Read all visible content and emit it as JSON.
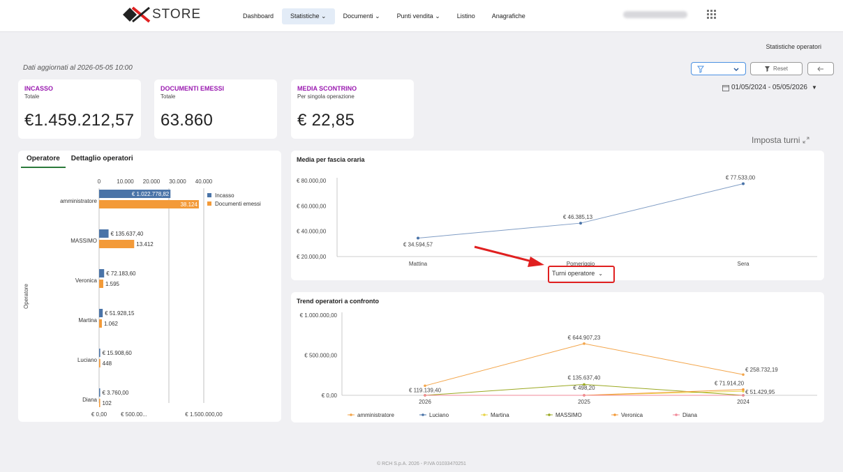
{
  "header": {
    "logo_text": "STORE",
    "nav": [
      {
        "label": "Dashboard"
      },
      {
        "label": "Statistiche ⌄"
      },
      {
        "label": "Documenti ⌄"
      },
      {
        "label": "Punti vendita ⌄"
      },
      {
        "label": "Listino"
      },
      {
        "label": "Anagrafiche"
      }
    ],
    "active_nav": "Statistiche",
    "apps_icon": "grid-icon"
  },
  "page": {
    "subtitle": "Statistiche operatori",
    "updated": "Dati aggiornati al 2026-05-05 10:00",
    "reset_label": "Reset",
    "date_range": "01/05/2024 - 05/05/2026",
    "shifts_label": "Imposta turni"
  },
  "kpis": [
    {
      "title": "INCASSO",
      "subtitle": "Totale",
      "value": "€1.459.212,57"
    },
    {
      "title": "DOCUMENTI EMESSI",
      "subtitle": "Totale",
      "value": "63.860"
    },
    {
      "title": "MEDIA SCONTRINO",
      "subtitle": "Per singola operazione",
      "value": "€ 22,85"
    }
  ],
  "tabs": {
    "operatore": "Operatore",
    "dettaglio": "Dettaglio operatori"
  },
  "ops_chart_text": {
    "y_axis_title": "Operatore",
    "top_ticks": [
      "0",
      "10.000",
      "20.000",
      "30.000",
      "40.000"
    ],
    "bottom_ticks": [
      "€ 0,00",
      "€ 500.00...",
      "€ 1.500.000,00"
    ],
    "legend": [
      "Incasso",
      "Documenti emessi"
    ]
  },
  "hourly_chart_title": "Media per fascia oraria",
  "hourly_y_ticks": [
    "€ 80.000,00",
    "€ 60.000,00",
    "€ 40.000,00",
    "€ 20.000,00"
  ],
  "shift_dropdown": "Turni operatore",
  "trend_chart_title": "Trend operatori a confronto",
  "trend_y_ticks": [
    "€ 1.000.000,00",
    "€ 500.000,00",
    "€ 0,00"
  ],
  "trend_labels": {
    "admin_2026": "€ 119.139,40",
    "admin_2025": "€ 644.907,23",
    "admin_2024": "€ 258.732,19",
    "massimo_2025": "€ 135.637,40",
    "veronica_2025": "€ 498,20",
    "veronica_2024": "€ 71.914,20",
    "martina_2024": "€ 51.429,95"
  },
  "footer": "© RCH S.p.A. 2026 - P.IVA 01033470251",
  "colors": {
    "accent": "#9a1ab0",
    "incasso": "#4a74a8",
    "documenti": "#f39a38",
    "line": "#7f9cc4"
  },
  "chart_data": [
    {
      "type": "bar",
      "orientation": "horizontal",
      "categories": [
        "amministratore",
        "MASSIMO",
        "Veronica",
        "Martina",
        "Luciano",
        "Diana"
      ],
      "series": [
        {
          "name": "Incasso",
          "axis": "bottom",
          "values": [
            1022778.82,
            135637.4,
            72183.6,
            51928.15,
            15908.6,
            3760.0
          ],
          "labels": [
            "€ 1.022.778,82",
            "€ 135.637,40",
            "€ 72.183,60",
            "€ 51.928,15",
            "€ 15.908,60",
            "€ 3.760,00"
          ]
        },
        {
          "name": "Documenti emessi",
          "axis": "top",
          "values": [
            38124,
            13412,
            1595,
            1062,
            448,
            102
          ],
          "labels": [
            "38.124",
            "13.412",
            "1.595",
            "1.062",
            "448",
            "102"
          ]
        }
      ],
      "ylabel": "Operatore",
      "xlim_top": [
        0,
        40000
      ],
      "xlim_bottom": [
        0,
        1500000
      ],
      "legend": "right"
    },
    {
      "type": "line",
      "title": "Media per fascia oraria",
      "categories": [
        "Mattina",
        "Pomeriggio",
        "Sera"
      ],
      "series": [
        {
          "values": [
            34594.57,
            46385.13,
            77533.0
          ],
          "labels": [
            "€ 34.594,57",
            "€ 46.385,13",
            "€ 77.533,00"
          ]
        }
      ],
      "ylim": [
        20000,
        80000
      ]
    },
    {
      "type": "line",
      "title": "Trend operatori a confronto",
      "categories": [
        "2026",
        "2025",
        "2024"
      ],
      "series": [
        {
          "name": "amministratore",
          "color": "#f3a54a",
          "values": [
            119139.4,
            644907.23,
            258732.19
          ]
        },
        {
          "name": "Luciano",
          "color": "#4a74a8",
          "values": [
            0,
            0,
            0
          ]
        },
        {
          "name": "Martina",
          "color": "#e8d54a",
          "values": [
            0,
            0,
            51429.95
          ]
        },
        {
          "name": "MASSIMO",
          "color": "#9aa820",
          "values": [
            0,
            135637.4,
            0
          ]
        },
        {
          "name": "Veronica",
          "color": "#f39a38",
          "values": [
            0,
            498.2,
            71914.2
          ]
        },
        {
          "name": "Diana",
          "color": "#f28a9a",
          "values": [
            0,
            0,
            0
          ]
        }
      ],
      "ylim": [
        0,
        1000000
      ],
      "legend": "bottom"
    }
  ]
}
